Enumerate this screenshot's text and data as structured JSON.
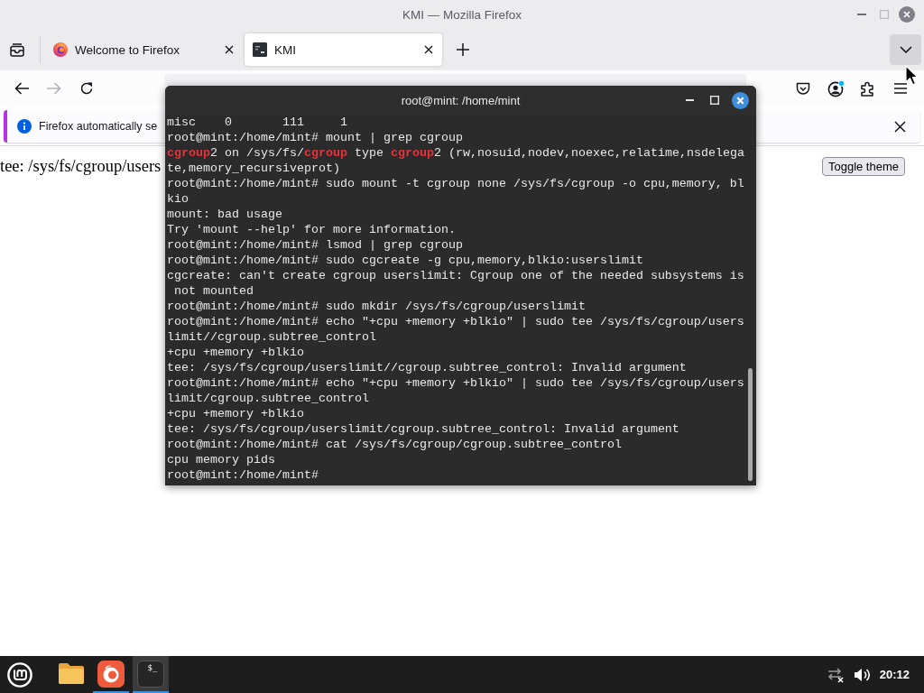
{
  "window": {
    "title": "KMI — Mozilla Firefox",
    "maximize_disabled": true
  },
  "tabs": [
    {
      "kind": "browser",
      "label": "Welcome to Firefox",
      "selected": false
    },
    {
      "kind": "site",
      "label": "KMI",
      "selected": true
    }
  ],
  "tab_list_button": {
    "highlighted": true
  },
  "navigation": {
    "forward_disabled": true
  },
  "toolbar": {
    "account_badge": true
  },
  "notification": {
    "text": "Firefox automatically se"
  },
  "page": {
    "text": "tee: /sys/fs/cgroup/users",
    "toggle_button": "Toggle theme"
  },
  "terminal": {
    "title": "root@mint: /home/mint",
    "lines": [
      "misc    0       111     1",
      "root@mint:/home/mint# mount | grep cgroup",
      "**cgroup**2 on /sys/fs/**cgroup** type **cgroup**2 (rw,nosuid,nodev,noexec,relatime,nsdelega",
      "te,memory_recursiveprot)",
      "root@mint:/home/mint# sudo mount -t cgroup none /sys/fs/cgroup -o cpu,memory, bl",
      "kio",
      "mount: bad usage",
      "Try 'mount --help' for more information.",
      "root@mint:/home/mint# lsmod | grep cgroup",
      "root@mint:/home/mint# sudo cgcreate -g cpu,memory,blkio:userslimit",
      "cgcreate: can't create cgroup userslimit: Cgroup one of the needed subsystems is",
      " not mounted",
      "root@mint:/home/mint# sudo mkdir /sys/fs/cgroup/userslimit",
      "root@mint:/home/mint# echo \"+cpu +memory +blkio\" | sudo tee /sys/fs/cgroup/users",
      "limit//cgroup.subtree_control",
      "+cpu +memory +blkio",
      "tee: /sys/fs/cgroup/userslimit//cgroup.subtree_control: Invalid argument",
      "root@mint:/home/mint# echo \"+cpu +memory +blkio\" | sudo tee /sys/fs/cgroup/users",
      "limit/cgroup.subtree_control",
      "+cpu +memory +blkio",
      "tee: /sys/fs/cgroup/userslimit/cgroup.subtree_control: Invalid argument",
      "root@mint:/home/mint# cat /sys/fs/cgroup/cgroup.subtree_control",
      "cpu memory pids",
      "root@mint:/home/mint#"
    ]
  },
  "taskbar": {
    "launchers": [
      {
        "kind": "files",
        "running": false,
        "selected": false
      },
      {
        "kind": "browser",
        "running": true,
        "selected": false
      },
      {
        "kind": "terminal",
        "running": true,
        "selected": true,
        "glyph": "$_"
      }
    ],
    "clock": "20:12"
  }
}
